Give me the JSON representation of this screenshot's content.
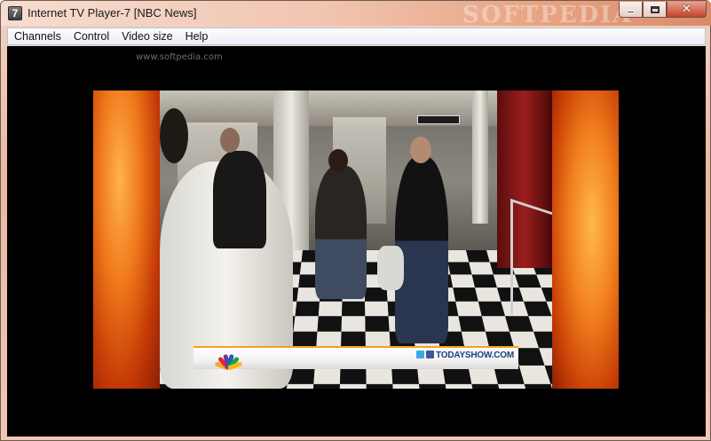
{
  "window": {
    "app_icon_label": "7",
    "title": "Internet TV Player-7  [NBC News]",
    "watermark_title": "SOFTPEDIA",
    "buttons": {
      "minimize": "minimize",
      "maximize": "maximize",
      "close": "close",
      "close_glyph": "✕"
    }
  },
  "menu": {
    "items": [
      {
        "label": "Channels"
      },
      {
        "label": "Control"
      },
      {
        "label": "Video size"
      },
      {
        "label": "Help"
      }
    ]
  },
  "video": {
    "site_watermark": "www.softpedia.com",
    "lower_third": {
      "url": "TODAYSHOW.COM"
    }
  },
  "colors": {
    "title_gradient_end": "#d98a68",
    "close_button": "#c5432b",
    "side_panel_orange": "#f07a1c",
    "lower_third_accent": "#f4a21e"
  }
}
